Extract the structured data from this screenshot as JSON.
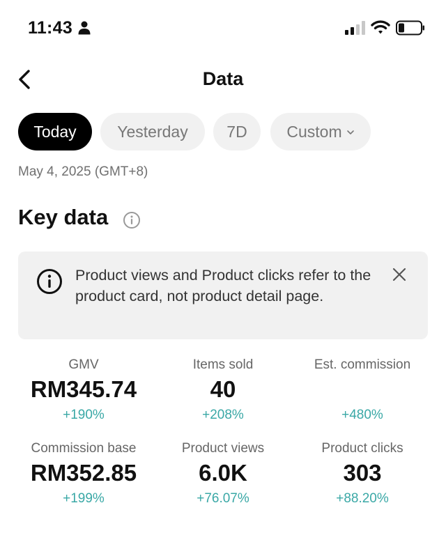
{
  "status_bar": {
    "time": "11:43"
  },
  "header": {
    "title": "Data"
  },
  "tabs": [
    {
      "label": "Today",
      "active": true
    },
    {
      "label": "Yesterday",
      "active": false
    },
    {
      "label": "7D",
      "active": false
    },
    {
      "label": "Custom",
      "active": false
    }
  ],
  "date_label": "May 4, 2025 (GMT+8)",
  "section": {
    "title": "Key data"
  },
  "notice": {
    "text": "Product views and Product clicks refer to the product card, not product detail page."
  },
  "metrics": [
    {
      "label": "GMV",
      "value": "RM345.74",
      "change": "+190%"
    },
    {
      "label": "Items sold",
      "value": "40",
      "change": "+208%"
    },
    {
      "label": "Est. commission",
      "value": "",
      "change": "+480%"
    },
    {
      "label": "Commission base",
      "value": "RM352.85",
      "change": "+199%"
    },
    {
      "label": "Product views",
      "value": "6.0K",
      "change": "+76.07%"
    },
    {
      "label": "Product clicks",
      "value": "303",
      "change": "+88.20%"
    }
  ],
  "colors": {
    "accent_teal": "#3aa8a6",
    "active_tab_bg": "#000000",
    "inactive_tab_bg": "#f1f1f1"
  },
  "icons": [
    "person-icon",
    "signal-icon",
    "wifi-icon",
    "battery-icon",
    "back-icon",
    "chevron-down-icon",
    "info-icon",
    "close-icon"
  ]
}
